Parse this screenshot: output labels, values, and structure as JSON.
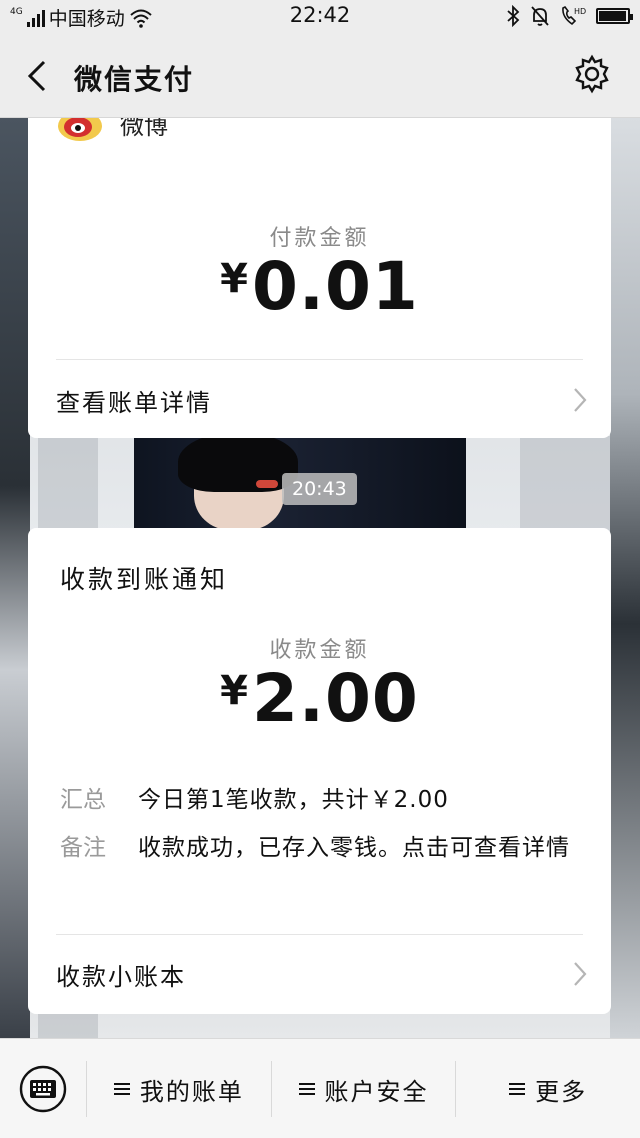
{
  "status_bar": {
    "network": "4G",
    "carrier": "中国移动",
    "time": "22:42",
    "battery_level": 0.95
  },
  "nav": {
    "title": "微信支付"
  },
  "payment_card": {
    "merchant": "微博",
    "amount_label": "付款金额",
    "currency": "¥",
    "amount": "0.01",
    "link_label": "查看账单详情"
  },
  "chat_time": "20:43",
  "receipt_card": {
    "title": "收款到账通知",
    "amount_label": "收款金额",
    "currency": "¥",
    "amount": "2.00",
    "summary_label": "汇总",
    "summary_value": "今日第1笔收款，共计￥2.00",
    "note_label": "备注",
    "note_value": "收款成功，已存入零钱。点击可查看详情",
    "link_label": "收款小账本"
  },
  "bottom_menu": {
    "items": [
      {
        "label": "我的账单"
      },
      {
        "label": "账户安全"
      },
      {
        "label": "更多"
      }
    ]
  },
  "colors": {
    "nav_bg": "#ededed",
    "card_bg": "#ffffff",
    "muted_text": "#8a8a8a"
  }
}
